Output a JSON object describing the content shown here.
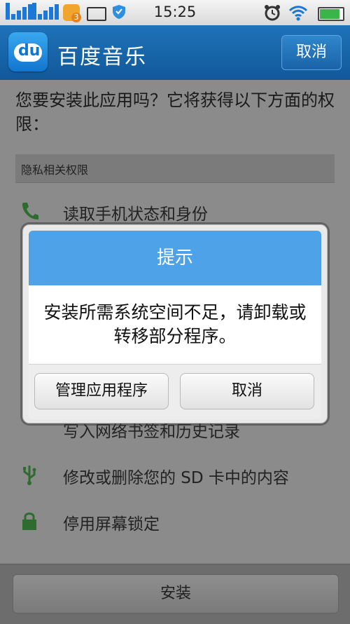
{
  "status_bar": {
    "time": "15:25",
    "signal_1_label": "1",
    "signal_2_label": "2",
    "notification_count": "3",
    "accent_color": "#1b78d6"
  },
  "app_header": {
    "logo_text": "du",
    "title": "百度音乐",
    "cancel_label": "取消"
  },
  "install": {
    "prompt": "您要安装此应用吗？它将获得以下方面的权限：",
    "section_title": "隐私相关权限",
    "permissions": [
      {
        "label": "读取手机状态和身份",
        "icon": "phone-icon"
      },
      {
        "label": "写入网络书签和历史记录",
        "icon": "globe-icon"
      },
      {
        "label": "修改或删除您的 SD 卡中的内容",
        "icon": "usb-icon"
      },
      {
        "label": "停用屏幕锁定",
        "icon": "lock-icon"
      }
    ],
    "install_label": "安装"
  },
  "dialog": {
    "title": "提示",
    "message": "安装所需系统空间不足，请卸载或转移部分程序。",
    "manage_label": "管理应用程序",
    "cancel_label": "取消",
    "header_color": "#4ea3e8"
  }
}
